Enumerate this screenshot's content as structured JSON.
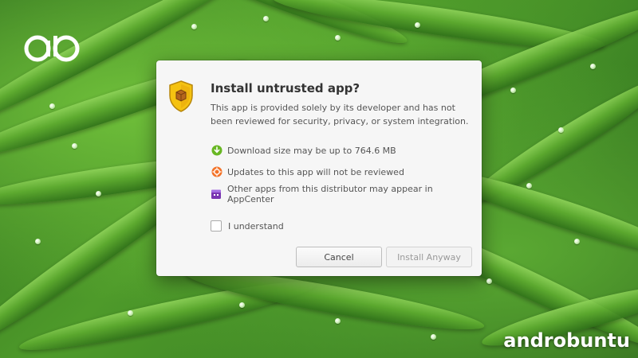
{
  "wallpaper": {
    "accent": "#5daa2f"
  },
  "brand": {
    "logo_icon": "ab-logo-icon",
    "watermark": "androbuntu"
  },
  "dialog": {
    "title": "Install untrusted app?",
    "description": "This app is provided solely by its developer and has not been reviewed for security, privacy, or system integration.",
    "items": [
      {
        "icon": "download-icon",
        "text": "Download size may be up to 764.6 MB"
      },
      {
        "icon": "updates-warning-icon",
        "text": "Updates to this app will not be reviewed"
      },
      {
        "icon": "store-icon",
        "text": "Other apps from this distributor may appear in AppCenter"
      }
    ],
    "checkbox": {
      "label": "I understand",
      "checked": false
    },
    "buttons": {
      "cancel": "Cancel",
      "install": "Install Anyway",
      "install_enabled": false
    }
  }
}
